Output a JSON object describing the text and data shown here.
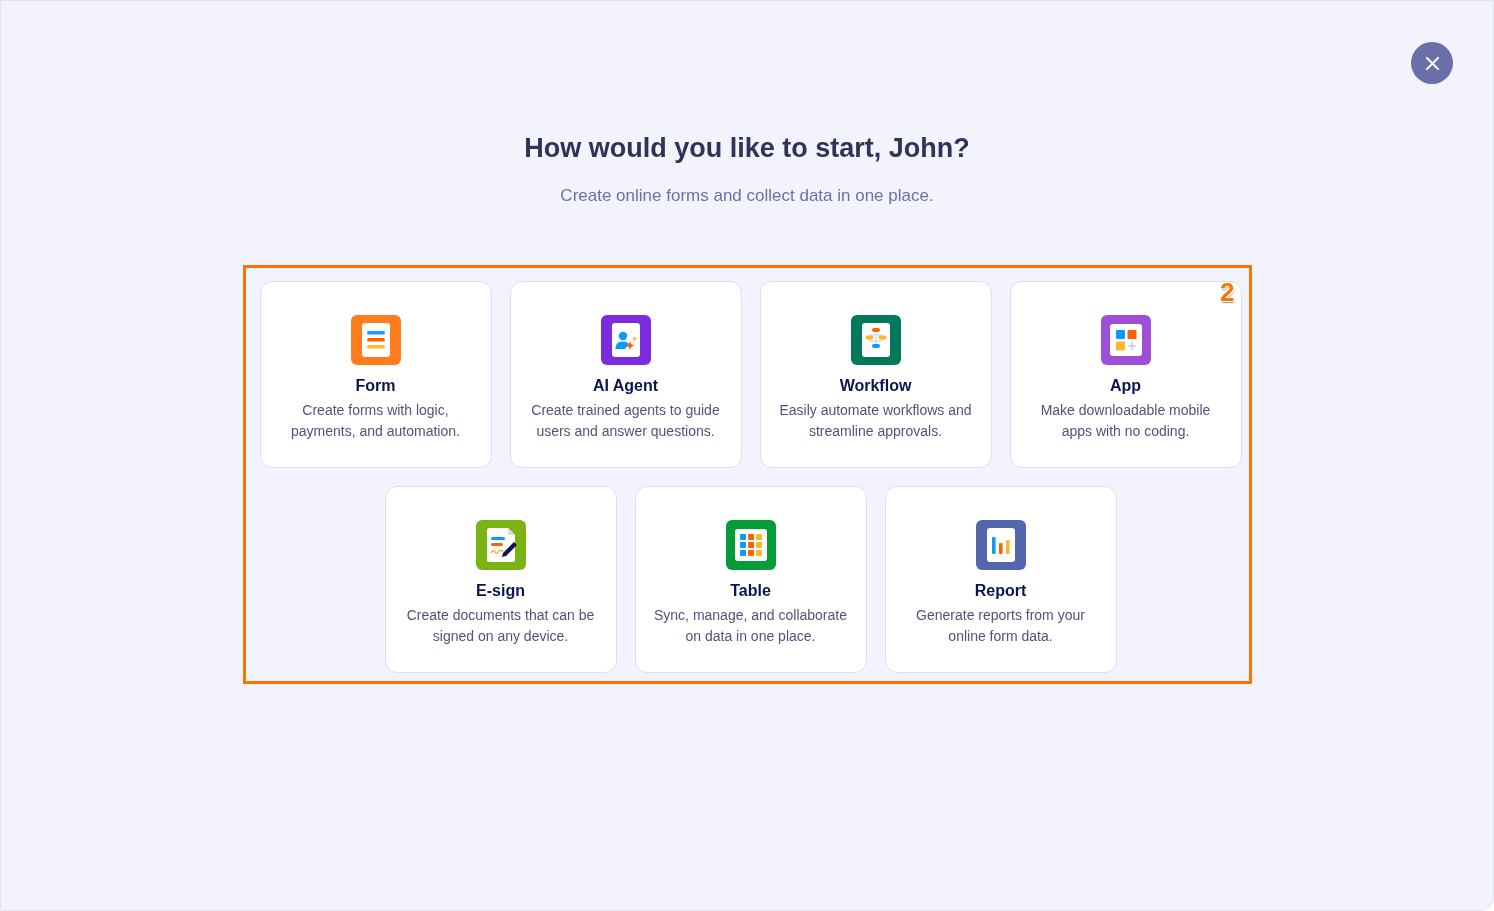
{
  "heading": "How would you like to start, John?",
  "subtitle": "Create online forms and collect data in one place.",
  "options": [
    {
      "kind": "form",
      "color": "#ff7d1f",
      "title": "Form",
      "description": "Create forms with logic,\npayments, and automation."
    },
    {
      "kind": "agent",
      "color": "#7b2dde",
      "title": "AI Agent",
      "description": "Create trained agents to guide\nusers and answer questions."
    },
    {
      "kind": "workflow",
      "color": "#03795b",
      "title": "Workflow",
      "description": "Easily automate workflows and\nstreamline approvals."
    },
    {
      "kind": "app",
      "color": "#9f4fd6",
      "title": "App",
      "description": "Make downloadable mobile\napps with no coding."
    },
    {
      "kind": "esign",
      "color": "#7bb312",
      "title": "E-sign",
      "description": "Create documents that can be\nsigned on any device."
    },
    {
      "kind": "table",
      "color": "#069d39",
      "title": "Table",
      "description": "Sync, manage, and collaborate\non data in one place."
    },
    {
      "kind": "report",
      "color": "#5467ad",
      "title": "Report",
      "description": "Generate reports from your\nonline form data."
    }
  ],
  "annotation": {
    "label": "2"
  }
}
